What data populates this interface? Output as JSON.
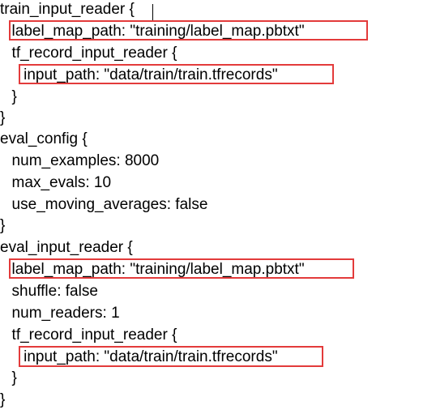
{
  "code": {
    "lines": [
      "train_input_reader {",
      "  label_map_path: \"training/label_map.pbtxt\"",
      "  tf_record_input_reader {",
      "    input_path: \"data/train/train.tfrecords\"",
      "  }",
      "}",
      "eval_config {",
      "  num_examples: 8000",
      "  max_evals: 10",
      "  use_moving_averages: false",
      "}",
      "eval_input_reader {",
      "  label_map_path: \"training/label_map.pbtxt\"",
      "  shuffle: false",
      "  num_readers: 1",
      "  tf_record_input_reader {",
      "    input_path: \"data/train/train.tfrecords\"",
      "  }",
      "}"
    ]
  },
  "highlight_color": "#e33b3b"
}
